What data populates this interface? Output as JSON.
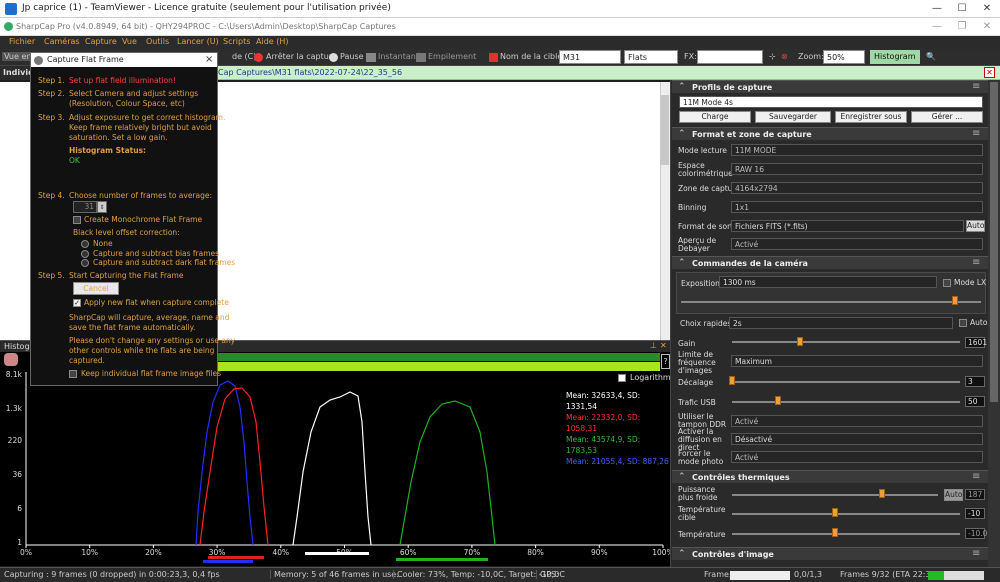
{
  "teamviewer": {
    "title": "Jp caprice (1) - TeamViewer - Licence gratuite (seulement pour l'utilisation privée)"
  },
  "app": {
    "title": "SharpCap Pro (v4.0.8949, 64 bit)  -  QHY294PROC  -  C:\\Users\\Admin\\Desktop\\SharpCap Captures"
  },
  "menu": [
    "Fichier",
    "Caméras",
    "Capture",
    "Vue",
    "Outils",
    "Lancer (U)",
    "Scripts",
    "Aide (H)"
  ],
  "toolbar": {
    "stop": "Arrêter la capture",
    "pause": "Pause",
    "snapshot": "Instantané",
    "stack": "Empilement",
    "target_label": "Nom de la cible:",
    "target_value": "M31",
    "flats_value": "Flats",
    "fx_label": "FX:",
    "zoom_label": "Zoom:",
    "zoom_value": "50%",
    "histogram": "Histogram",
    "vue_short": "Vue en",
    "individ": "Individ",
    "capture_c": "de (C)"
  },
  "infobar": {
    "path": "Cap Captures\\M31 flats\\2022-07-24\\22_35_56"
  },
  "histogram": {
    "title": "Histogra",
    "log_label": "Logarithmic",
    "help": "?",
    "y_ticks": [
      "8.1k",
      "1.3k",
      "220",
      "36",
      "6",
      "1"
    ],
    "x_ticks": [
      "0%",
      "10%",
      "20%",
      "30%",
      "40%",
      "50%",
      "60%",
      "70%",
      "80%",
      "90%",
      "100%"
    ],
    "stats": [
      {
        "text": "Mean: 32633,4,  SD: 1331,54",
        "color": "#ffffff"
      },
      {
        "text": "Mean: 22332,0,  SD: 1058,31",
        "color": "#ff3030"
      },
      {
        "text": "Mean: 43574,9,  SD: 1783,53",
        "color": "#30c030"
      },
      {
        "text": "Mean: 21055,4,  SD: 887,26",
        "color": "#4060ff"
      }
    ]
  },
  "status": {
    "capture": "Capturing : 9 frames (0 dropped) in 0:00:23,3, 0,4 fps",
    "memory": "Memory: 5 of 46 frames in use.",
    "cooler": "Cooler: 73%, Temp: -10,0C, Target: -10,0C",
    "gps": "GPS:",
    "frame_label": "Frame:",
    "frame_value": "0,0/1,3",
    "frames_eta": "Frames 9/32 (ETA 22:36)",
    "frames_progress": 0.28
  },
  "dialog": {
    "title": "Capture Flat Frame",
    "close": "×",
    "step1_label": "Step 1.",
    "step1_text": "Set up flat field illumination!",
    "step2_label": "Step 2.",
    "step2_text": [
      "Select Camera and adjust settings",
      "(Resolution, Colour Space, etc)"
    ],
    "step3_label": "Step 3.",
    "step3_text": [
      "Adjust exposure to get correct histogram.",
      "Keep frame relatively bright but avoid",
      "saturation. Set a low gain."
    ],
    "histogram_status_label": "Histogram Status:",
    "histogram_status_value": "OK",
    "step4_label": "Step 4.",
    "step4_text": "Choose number of frames to average:",
    "frames_value": "31",
    "mono_label": "Create Monochrome Flat Frame",
    "black_offset_label": "Black level offset correction:",
    "radio_none": "None",
    "radio_bias": "Capture and subtract bias frames",
    "radio_dark": "Capture and subtract dark flat frames",
    "step5_label": "Step 5.",
    "step5_text": "Start Capturing the Flat Frame",
    "cancel": "Cancel",
    "apply_label": "Apply new flat when capture complete",
    "info1": [
      "SharpCap will capture, average, name and",
      "save the flat frame automatically."
    ],
    "info2": [
      "Please don't change any settings or use any",
      "other controls while the flats are being",
      "captured."
    ],
    "keep_label": "Keep individual flat frame image files"
  },
  "panel": {
    "profiles_title": "Profils de capture",
    "profile_value": "11M Mode 4s",
    "btn_charge": "Charge",
    "btn_save": "Sauvegarder",
    "btn_save_as": "Enregistrer sous ...",
    "btn_manage": "Gérer ...",
    "format_title": "Format et zone de capture",
    "mode_label": "Mode lecture",
    "mode_value": "11M MODE",
    "colour_label": "Espace colorimétrique",
    "colour_value": "RAW 16",
    "zone_label": "Zone de capture",
    "zone_value": "4164x2794",
    "binning_label": "Binning",
    "binning_value": "1x1",
    "output_label": "Format de sortie",
    "output_value": "Fichiers FITS (*.fits)",
    "output_auto": "Auto",
    "debayer_label": "Aperçu de Debayer",
    "debayer_value": "Activé",
    "camera_title": "Commandes de la caméra",
    "exposure_label": "Exposition",
    "exposure_value": "1300 ms",
    "mode_lx": "Mode LX",
    "quick_label": "Choix rapides",
    "quick_value": "2s",
    "auto": "Auto",
    "gain_label": "Gain",
    "gain_value": "1601",
    "gain_level": 0.3,
    "framerate_label": "Limite de fréquence d'images",
    "framerate_value": "Maximum",
    "offset_label": "Décalage",
    "offset_value": "3",
    "offset_level": 0.0,
    "usb_label": "Trafic USB",
    "usb_value": "50",
    "usb_level": 0.2,
    "ddr_label": "Utiliser le tampon DDR",
    "ddr_value": "Activé",
    "broadcast_label": "Activer la diffusion en direct",
    "broadcast_value": "Désactivé",
    "force_label": "Forcer le mode photo",
    "force_value": "Activé",
    "thermal_title": "Contrôles thermiques",
    "cooler_label": "Puissance plus froide",
    "cooler_auto": "Auto",
    "cooler_value": "187",
    "cooler_level": 0.73,
    "target_temp_label": "Température cible",
    "target_temp_value": "-10",
    "target_temp_level": 0.45,
    "temp_label": "Température",
    "temp_value": "-10.0",
    "temp_level": 0.45,
    "image_title": "Contrôles d'image"
  }
}
